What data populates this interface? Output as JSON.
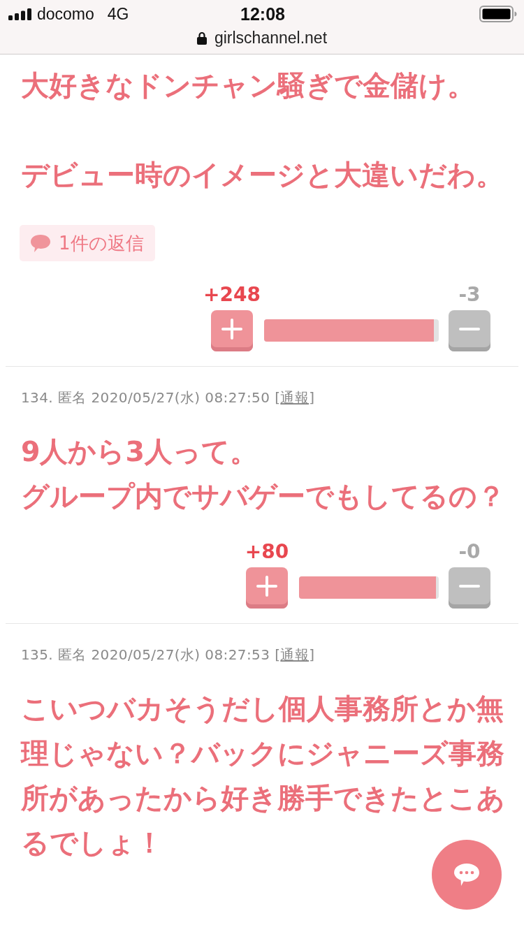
{
  "status_bar": {
    "carrier": "docomo",
    "network": "4G",
    "time": "12:08"
  },
  "address_bar": {
    "url": "girlschannel.net"
  },
  "comments": [
    {
      "paragraphs": [
        [
          "大好きなドンチャン騒ぎで金儲け。"
        ],
        [
          "デビュー時のイメージと大違いだわ。"
        ]
      ],
      "replies": "1件の返信",
      "votes": {
        "plus": "+248",
        "minus": "-3",
        "level": 0.97
      }
    },
    {
      "header": {
        "number": "134.",
        "author": "匿名",
        "posted": "2020/05/27(水) 08:27:50",
        "report_open": "[",
        "report": "通報",
        "report_close": "]"
      },
      "paragraphs": [
        [
          "9人から3人って。",
          "グループ内でサバゲーでもしてるの？"
        ]
      ],
      "votes": {
        "plus": "+80",
        "minus": "-0",
        "level": 0.98
      }
    },
    {
      "header": {
        "number": "135.",
        "author": "匿名",
        "posted": "2020/05/27(水) 08:27:53",
        "report_open": "[",
        "report": "通報",
        "report_close": "]"
      },
      "paragraphs": [
        [
          "こいつバカそうだし個人事務所とか無",
          "理じゃない？バックにジャニーズ事務",
          "所があったから好き勝手できたとこあ",
          "るでしょ！"
        ]
      ]
    }
  ]
}
